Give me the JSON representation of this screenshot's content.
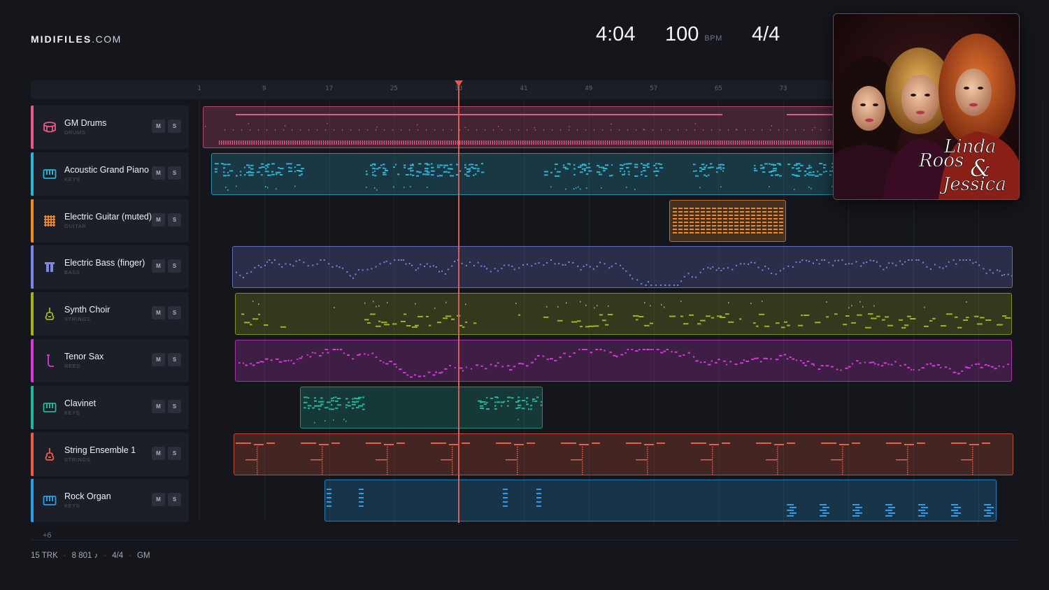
{
  "header": {
    "logo_bold": "MIDIFILES",
    "logo_rest": ".COM",
    "time": "4:04",
    "bpm": "100",
    "bpm_unit": "BPM",
    "time_signature": "4/4"
  },
  "ruler": {
    "bars": [
      "1",
      "9",
      "17",
      "25",
      "33",
      "41",
      "49",
      "57",
      "65",
      "73"
    ],
    "playhead_bar": 33
  },
  "tracks": [
    {
      "name": "GM Drums",
      "category": "DRUMS",
      "icon": "drum-icon",
      "color": "#e8588a",
      "mute": "M",
      "solo": "S"
    },
    {
      "name": "Acoustic Grand Piano",
      "category": "KEYS",
      "icon": "piano-keys-icon",
      "color": "#2fb3d3",
      "mute": "M",
      "solo": "S"
    },
    {
      "name": "Electric Guitar (muted)",
      "category": "GUITAR",
      "icon": "guitar-fretboard-icon",
      "color": "#f08a24",
      "mute": "M",
      "solo": "S"
    },
    {
      "name": "Electric Bass (finger)",
      "category": "BASS",
      "icon": "bass-icon",
      "color": "#7b86e8",
      "mute": "M",
      "solo": "S"
    },
    {
      "name": "Synth Choir",
      "category": "STRINGS",
      "icon": "violin-icon",
      "color": "#a3b41f",
      "mute": "M",
      "solo": "S"
    },
    {
      "name": "Tenor Sax",
      "category": "REED",
      "icon": "saxophone-icon",
      "color": "#d63ad8",
      "mute": "M",
      "solo": "S"
    },
    {
      "name": "Clavinet",
      "category": "KEYS",
      "icon": "piano-keys-icon",
      "color": "#22b79a",
      "mute": "M",
      "solo": "S"
    },
    {
      "name": "String Ensemble 1",
      "category": "STRINGS",
      "icon": "violin-icon",
      "color": "#ef5c45",
      "mute": "M",
      "solo": "S"
    },
    {
      "name": "Rock Organ",
      "category": "KEYS",
      "icon": "piano-keys-icon",
      "color": "#2a9ee8",
      "mute": "M",
      "solo": "S"
    }
  ],
  "more_tracks": "+6",
  "footer": {
    "tracks": "15 TRK",
    "notes": "8 801 ♪",
    "time_signature": "4/4",
    "standard": "GM"
  },
  "album": {
    "title_line1": "Linda",
    "title_line2": "Roos",
    "title_amp": "&",
    "title_line3": "Jessica"
  }
}
